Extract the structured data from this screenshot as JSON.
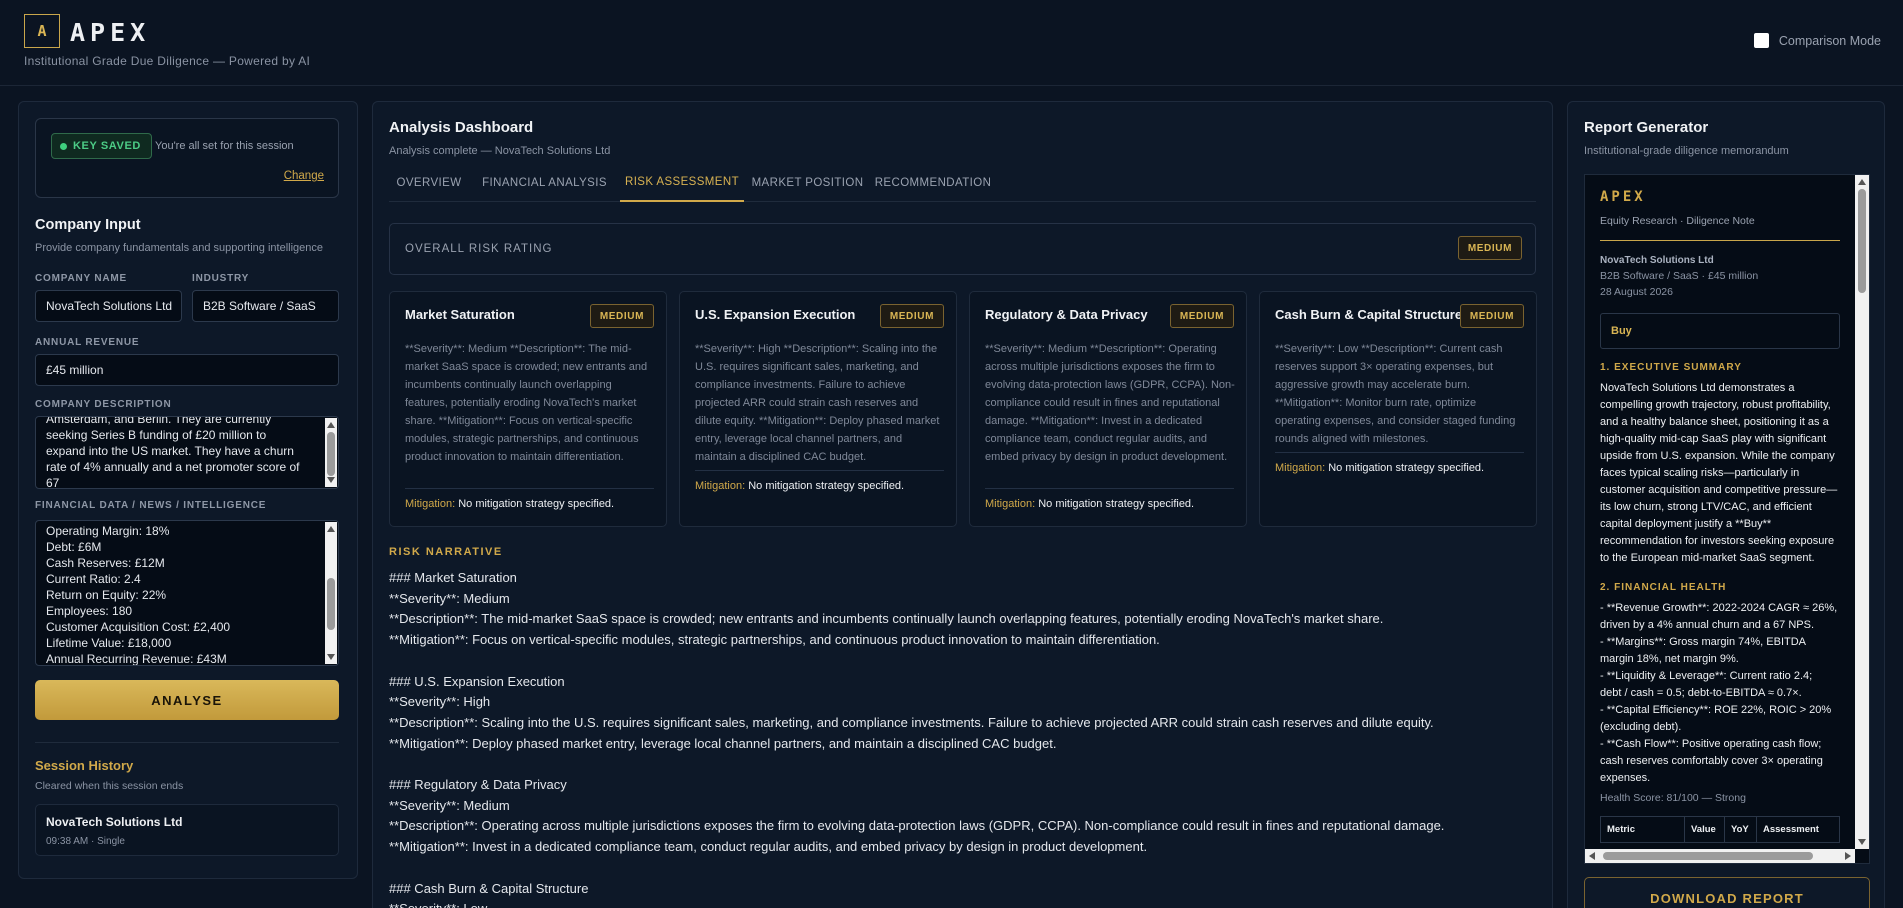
{
  "header": {
    "logo_letter": "A",
    "app_name": "APEX",
    "tagline": "Institutional Grade Due Diligence — Powered by AI",
    "comparison_label": "Comparison Mode"
  },
  "left": {
    "key_badge": "KEY SAVED",
    "key_note": "You're all set for this session",
    "change_link": "Change",
    "title": "Company Input",
    "subtitle": "Provide company fundamentals and supporting intelligence",
    "company_name_label": "COMPANY NAME",
    "company_name_value": "NovaTech Solutions Ltd",
    "industry_label": "INDUSTRY",
    "industry_value": "B2B Software / SaaS",
    "revenue_label": "ANNUAL REVENUE",
    "revenue_value": "£45 million",
    "description_label": "COMPANY DESCRIPTION",
    "description_lines": [
      "Amsterdam, and Berlin. They are currently",
      "seeking Series B funding of £20 million to",
      "expand into the US market. They have a churn",
      "rate of 4% annually and a net promoter score of",
      "67"
    ],
    "financial_label": "FINANCIAL DATA / NEWS / INTELLIGENCE",
    "financial_lines": [
      "Operating Margin: 18%",
      "Debt: £6M",
      "Cash Reserves: £12M",
      "Current Ratio: 2.4",
      "Return on Equity: 22%",
      "Employees: 180",
      "Customer Acquisition Cost: £2,400",
      "Lifetime Value: £18,000",
      "Annual Recurring Revenue: £43M"
    ],
    "analyse_button": "ANALYSE",
    "history_title": "Session History",
    "history_sub": "Cleared when this session ends",
    "history_items": [
      {
        "name": "NovaTech Solutions Ltd",
        "meta": "09:38 AM · Single"
      }
    ]
  },
  "middle": {
    "title": "Analysis Dashboard",
    "subtitle": "Analysis complete — NovaTech Solutions Ltd",
    "tabs": [
      "OVERVIEW",
      "FINANCIAL ANALYSIS",
      "RISK ASSESSMENT",
      "MARKET POSITION",
      "RECOMMENDATION"
    ],
    "active_tab": "RISK ASSESSMENT",
    "overall_label": "OVERALL RISK RATING",
    "overall_rating": "MEDIUM",
    "mitigation_key": "Mitigation:",
    "cards": [
      {
        "title": "Market Saturation",
        "rating": "MEDIUM",
        "desc": "**Severity**: Medium **Description**: The mid-market SaaS space is crowded; new entrants and incumbents continually launch overlapping features, potentially eroding NovaTech's market share. **Mitigation**: Focus on vertical-specific modules, strategic partnerships, and continuous product innovation to maintain differentiation.",
        "mitigation": "No mitigation strategy specified."
      },
      {
        "title": "U.S. Expansion Execution",
        "rating": "MEDIUM",
        "desc": "**Severity**: High **Description**: Scaling into the U.S. requires significant sales, marketing, and compliance investments. Failure to achieve projected ARR could strain cash reserves and dilute equity. **Mitigation**: Deploy phased market entry, leverage local channel partners, and maintain a disciplined CAC budget.",
        "mitigation": "No mitigation strategy specified."
      },
      {
        "title": "Regulatory & Data Privacy",
        "rating": "MEDIUM",
        "desc": "**Severity**: Medium **Description**: Operating across multiple jurisdictions exposes the firm to evolving data-protection laws (GDPR, CCPA). Non-compliance could result in fines and reputational damage. **Mitigation**: Invest in a dedicated compliance team, conduct regular audits, and embed privacy by design in product development.",
        "mitigation": "No mitigation strategy specified."
      },
      {
        "title": "Cash Burn & Capital Structure",
        "rating": "MEDIUM",
        "desc": "**Severity**: Low **Description**: Current cash reserves support 3× operating expenses, but aggressive growth may accelerate burn. **Mitigation**: Monitor burn rate, optimize operating expenses, and consider staged funding rounds aligned with milestones.",
        "mitigation": "No mitigation strategy specified."
      }
    ],
    "narrative_title": "RISK NARRATIVE",
    "narrative_lines": [
      "### Market Saturation",
      "**Severity**: Medium",
      "**Description**: The mid-market SaaS space is crowded; new entrants and incumbents continually launch overlapping features, potentially eroding NovaTech's market share.",
      "**Mitigation**: Focus on vertical-specific modules, strategic partnerships, and continuous product innovation to maintain differentiation.",
      "",
      "### U.S. Expansion Execution",
      "**Severity**: High",
      "**Description**: Scaling into the U.S. requires significant sales, marketing, and compliance investments. Failure to achieve projected ARR could strain cash reserves and dilute equity.",
      "**Mitigation**: Deploy phased market entry, leverage local channel partners, and maintain a disciplined CAC budget.",
      "",
      "### Regulatory & Data Privacy",
      "**Severity**: Medium",
      "**Description**: Operating across multiple jurisdictions exposes the firm to evolving data-protection laws (GDPR, CCPA). Non-compliance could result in fines and reputational damage.",
      "**Mitigation**: Invest in a dedicated compliance team, conduct regular audits, and embed privacy by design in product development.",
      "",
      "### Cash Burn & Capital Structure",
      "**Severity**: Low"
    ]
  },
  "right": {
    "title": "Report Generator",
    "subtitle": "Institutional-grade diligence memorandum",
    "doc_brand": "APEX",
    "doc_kind": "Equity Research · Diligence Note",
    "doc_company": "NovaTech Solutions Ltd",
    "doc_sector": "B2B Software / SaaS · £45 million",
    "doc_date": "28 August 2026",
    "doc_recommendation": "Buy",
    "section1_title": "1. EXECUTIVE SUMMARY",
    "section1_lines": [
      "NovaTech Solutions Ltd demonstrates a",
      "compelling growth trajectory, robust profitability,",
      "and a healthy balance sheet, positioning it as a",
      "high-quality mid-cap SaaS play with significant",
      "upside from U.S. expansion. While the company",
      "faces typical scaling risks—particularly in",
      "customer acquisition and competitive pressure—",
      "its low churn, strong LTV/CAC, and efficient",
      "capital deployment justify a **Buy**",
      "recommendation for investors seeking exposure",
      "to the European mid-market SaaS segment."
    ],
    "section2_title": "2. FINANCIAL HEALTH",
    "section2_lines": [
      "- **Revenue Growth**: 2022-2024 CAGR ≈ 26%,",
      "driven by a 4% annual churn and a 67 NPS.",
      "- **Margins**: Gross margin 74%, EBITDA",
      "margin 18%, net margin 9%.",
      "- **Liquidity & Leverage**: Current ratio 2.4;",
      "debt / cash = 0.5; debt-to-EBITDA ≈ 0.7×.",
      "- **Capital Efficiency**: ROE 22%, ROIC > 20%",
      "(excluding debt).",
      "- **Cash Flow**: Positive operating cash flow;",
      "cash reserves comfortably cover 3× operating",
      "expenses."
    ],
    "health_score": "Health Score: 81/100 — Strong",
    "table_headers": [
      "Metric",
      "Value",
      "YoY",
      "Assessment"
    ],
    "download_button": "DOWNLOAD REPORT"
  }
}
